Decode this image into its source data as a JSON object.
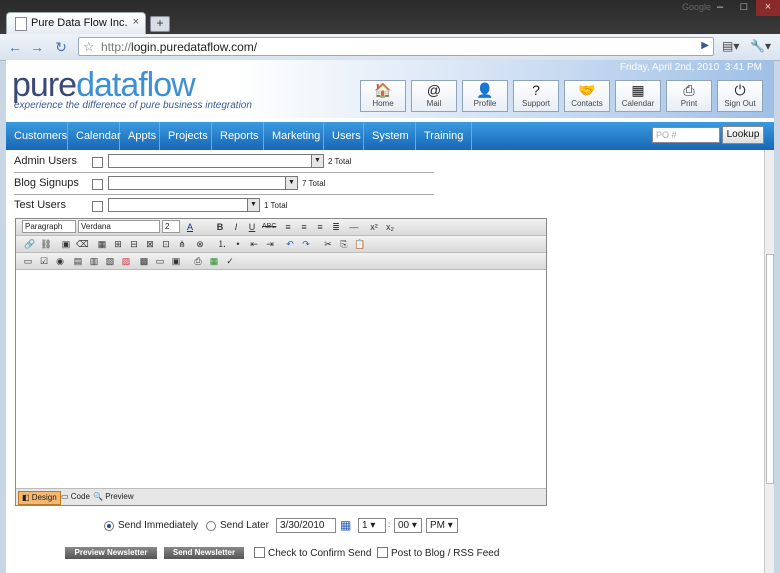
{
  "browser": {
    "tab_title": "Pure Data Flow Inc.",
    "tab_close": "×",
    "new_tab": "+",
    "watermark": "Google",
    "url_scheme": "http://",
    "url_host": "login.puredataflow.com/",
    "minimize": "–",
    "maximize": "□",
    "close": "×"
  },
  "header": {
    "logo_part1": "pure",
    "logo_part2": "dataflow",
    "tagline": "experience the difference of pure business integration",
    "date": "Friday, April 2nd, 2010",
    "time": "3:41 PM",
    "buttons": [
      {
        "label": "Home",
        "icon": "home-icon",
        "glyph": "🏠"
      },
      {
        "label": "Mail",
        "icon": "mail-icon",
        "glyph": "@"
      },
      {
        "label": "Profile",
        "icon": "profile-icon",
        "glyph": "👤"
      },
      {
        "label": "Support",
        "icon": "support-icon",
        "glyph": "?"
      },
      {
        "label": "Contacts",
        "icon": "contacts-icon",
        "glyph": "🤝"
      },
      {
        "label": "Calendar",
        "icon": "calendar-icon",
        "glyph": "▦"
      },
      {
        "label": "Print",
        "icon": "print-icon",
        "glyph": "⎙"
      },
      {
        "label": "Sign Out",
        "icon": "power-icon",
        "glyph": "⏻"
      }
    ]
  },
  "menu": {
    "items": [
      "Customers",
      "Calendar",
      "Appts",
      "Projects",
      "Reports",
      "Marketing",
      "Users",
      "System",
      "Training"
    ],
    "po_placeholder": "PO #",
    "lookup": "Lookup"
  },
  "form": {
    "rows": [
      {
        "label": "Admin Users",
        "total": "2 Total"
      },
      {
        "label": "Blog Signups",
        "total": "7 Total"
      },
      {
        "label": "Test Users",
        "total": "1 Total"
      }
    ]
  },
  "editor": {
    "format": "Paragraph",
    "font": "Verdana",
    "size": "2",
    "tabs": [
      "Design",
      "Code",
      "Preview"
    ]
  },
  "send": {
    "immediately": "Send Immediately",
    "later": "Send Later",
    "date": "3/30/2010",
    "hour": "1",
    "colon": ":",
    "minute": "00",
    "ampm": "PM",
    "preview_btn": "Preview Newsletter",
    "send_btn": "Send Newsletter",
    "confirm": "Check to Confirm Send",
    "post_blog": "Post to Blog / RSS Feed"
  },
  "colors": {
    "menu_bar": "#1f78c8",
    "logo_dark": "#3a4a78",
    "logo_light": "#3d8fd6"
  }
}
